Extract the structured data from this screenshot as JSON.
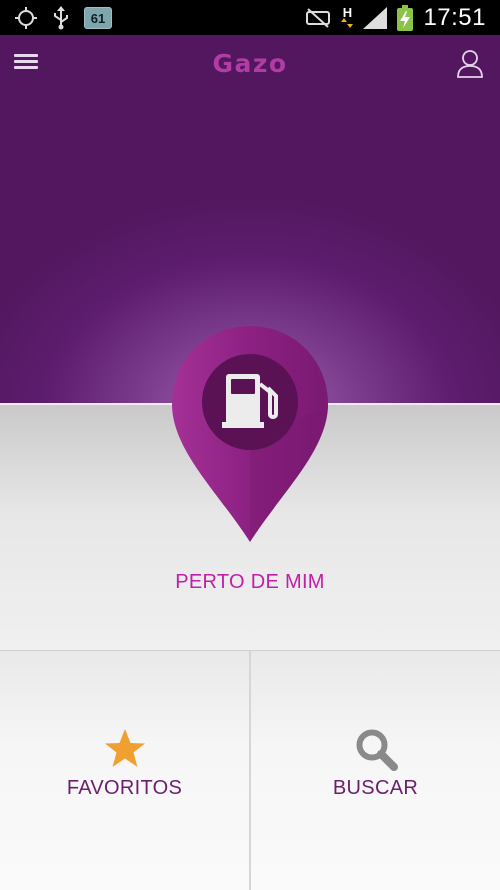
{
  "status_bar": {
    "icons": [
      "gps-icon",
      "usb-icon",
      "notification-61-icon",
      "mute-icon",
      "hsdpa-icon",
      "signal-icon",
      "battery-charging-icon"
    ],
    "notification_badge": "61",
    "network_type": "H",
    "time": "17:51"
  },
  "app": {
    "title": "Gazo",
    "menu_icon": "menu-icon",
    "profile_icon": "user-icon"
  },
  "main": {
    "nearby_label": "PERTO DE MIM",
    "pin_icon": "fuel-pump-icon"
  },
  "bottom_buttons": [
    {
      "label": "FAVORITOS",
      "icon": "star-icon"
    },
    {
      "label": "BUSCAR",
      "icon": "search-icon"
    }
  ],
  "colors": {
    "brand_purple": "#5e1d6f",
    "accent_magenta": "#c020a8",
    "label_purple": "#6a1f6e",
    "star_orange": "#f0a030",
    "search_gray": "#8a8a8a"
  }
}
